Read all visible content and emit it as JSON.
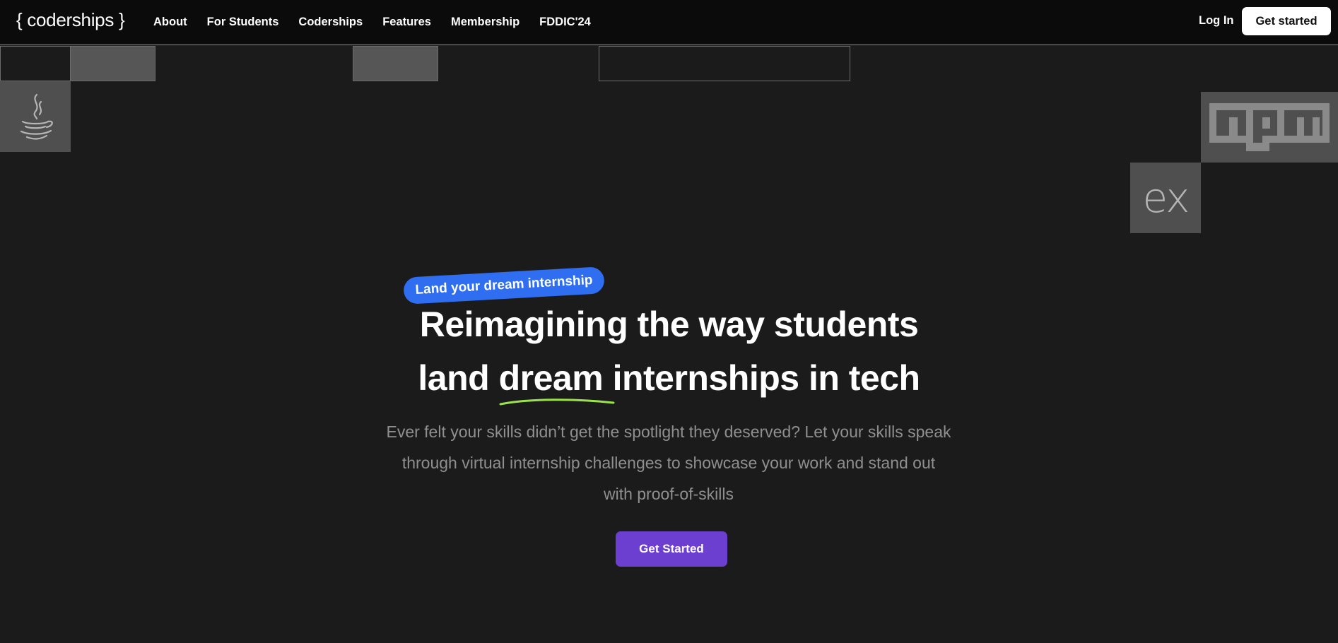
{
  "brand": {
    "logo": "{ coderships }"
  },
  "nav": {
    "links": [
      "About",
      "For Students",
      "Coderships",
      "Features",
      "Membership",
      "FDDIC'24"
    ],
    "login": "Log In",
    "cta": "Get started"
  },
  "hero": {
    "badge": "Land your dream internship",
    "headline_line1": "Reimagining the way students",
    "headline_pre": "land",
    "headline_highlight": "dream",
    "headline_post": "internships in tech",
    "subtitle": "Ever felt your skills didn’t get the spotlight they deserved? Let your skills speak through virtual internship challenges to showcase your work and stand out with proof-of-skills",
    "cta": "Get Started"
  },
  "tech_icons": {
    "java": "java-icon",
    "npm": "npm-icon",
    "express": "ex"
  },
  "colors": {
    "background": "#1b1b1b",
    "nav_background": "#0b0b0b",
    "badge": "#2f6ef0",
    "cta": "#6d3fd0",
    "underline": "#9be24c"
  }
}
